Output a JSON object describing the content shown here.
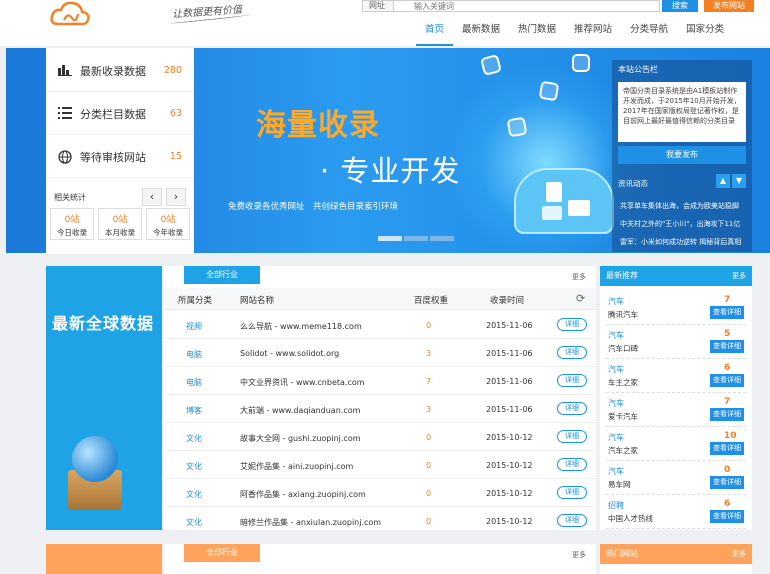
{
  "header": {
    "slogan": "让数据更有价值",
    "search_label": "网址",
    "search_placeholder": "输入关键词",
    "search_button": "搜索",
    "publish_button": "发布网站"
  },
  "nav": [
    "首页",
    "最新数据",
    "热门数据",
    "推荐网站",
    "分类导航",
    "国家分类"
  ],
  "stats": {
    "items": [
      {
        "label": "最新收录数据",
        "value": "280",
        "icon": "bar-chart-icon"
      },
      {
        "label": "分类栏目数据",
        "value": "63",
        "icon": "list-icon"
      },
      {
        "label": "等待审核网站",
        "value": "15",
        "icon": "globe-icon"
      }
    ],
    "related_label": "相关统计",
    "mini": [
      {
        "num": "0站",
        "label": "今日收录"
      },
      {
        "num": "0站",
        "label": "本月收录"
      },
      {
        "num": "0站",
        "label": "今年收录"
      }
    ]
  },
  "banner": {
    "headline1": "海量收录",
    "headline2": "· 专业开发",
    "subtitle": "免费收录各优秀网址　共创绿色目录索引环境"
  },
  "notice": {
    "title": "本站公告栏",
    "text": "帝国分类目录系统是由A1模板站制作开发而成，于2015年10月开始开发，2017年在国家版权局登记著作权，是目前网上最好最值得信赖的分类目录",
    "button": "我要发布",
    "news_title": "资讯动态",
    "news": [
      "共享单车集体出海，会成为欧美站稳脚",
      "中关村之外的\"王小川\"，出海攻下11亿",
      "雷军：小米如何成功逆转 揭秘背后真相"
    ]
  },
  "latest": {
    "block_title": "最新全球数据",
    "tab": "全部行业",
    "more": "更多",
    "columns": [
      "所属分类",
      "网站名称",
      "百度权重",
      "收录时间"
    ],
    "detail_label": "详细",
    "rows": [
      {
        "cat": "视频",
        "name": "么么导航 - www.meme118.com",
        "weight": "0",
        "date": "2015-11-06"
      },
      {
        "cat": "电脑",
        "name": "Solidot - www.solidot.org",
        "weight": "3",
        "date": "2015-11-06"
      },
      {
        "cat": "电脑",
        "name": "中文业界资讯 - www.cnbeta.com",
        "weight": "7",
        "date": "2015-11-06"
      },
      {
        "cat": "博客",
        "name": "大前端 - www.daqianduan.com",
        "weight": "3",
        "date": "2015-11-06"
      },
      {
        "cat": "文化",
        "name": "故事大全网 - gushi.zuopinj.com",
        "weight": "0",
        "date": "2015-10-12"
      },
      {
        "cat": "文化",
        "name": "艾妮作品集 - aini.zuopinj.com",
        "weight": "0",
        "date": "2015-10-12"
      },
      {
        "cat": "文化",
        "name": "阿香作品集 - axiang.zuopinj.com",
        "weight": "0",
        "date": "2015-10-12"
      },
      {
        "cat": "文化",
        "name": "暗修兰作品集 - anxiulan.zuopinj.com",
        "weight": "0",
        "date": "2015-10-12"
      }
    ]
  },
  "recommend": {
    "title": "最新推荐",
    "more": "更多",
    "button": "查看详细",
    "items": [
      {
        "cat": "汽车",
        "name": "腾讯汽车",
        "num": "7"
      },
      {
        "cat": "汽车",
        "name": "汽车口碑",
        "num": "5"
      },
      {
        "cat": "汽车",
        "name": "车主之家",
        "num": "6"
      },
      {
        "cat": "汽车",
        "name": "爱卡汽车",
        "num": "7"
      },
      {
        "cat": "汽车",
        "name": "汽车之家",
        "num": "10"
      },
      {
        "cat": "汽车",
        "name": "易车网",
        "num": "0"
      },
      {
        "cat": "招聘",
        "name": "中国人才热线",
        "num": "6"
      }
    ]
  },
  "second": {
    "tab": "全部行业",
    "more": "更多",
    "right_title": "热门网站",
    "right_more": "更多"
  }
}
